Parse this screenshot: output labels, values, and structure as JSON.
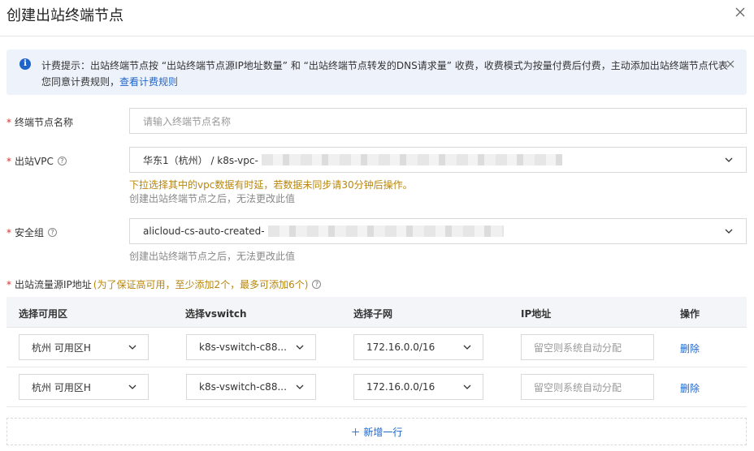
{
  "dialog": {
    "title": "创建出站终端节点"
  },
  "notice": {
    "text": "计费提示：出站终端节点按 “出站终端节点源IP地址数量” 和 “出站终端节点转发的DNS请求量” 收费，收费模式为按量付费后付费，主动添加出站终端节点代表您同意计费规则，",
    "link": "查看计费规则"
  },
  "form": {
    "name": {
      "label": "终端节点名称",
      "placeholder": "请输入终端节点名称"
    },
    "vpc": {
      "label": "出站VPC",
      "value": "华东1（杭州） / k8s-vpc-",
      "warning": "下拉选择其中的vpc数据有时延，若数据未同步请30分钟后操作。",
      "hint": "创建出站终端节点之后，无法更改此值"
    },
    "security_group": {
      "label": "安全组",
      "value": "alicloud-cs-auto-created-",
      "hint": "创建出站终端节点之后，无法更改此值"
    },
    "source_ip": {
      "label": "出站流量源IP地址",
      "note": "(为了保证高可用，至少添加2个，最多可添加6个)"
    }
  },
  "table": {
    "headers": [
      "选择可用区",
      "选择vswitch",
      "选择子网",
      "IP地址",
      "操作"
    ],
    "rows": [
      {
        "zone": "杭州 可用区H",
        "vswitch": "k8s-vswitch-c88...",
        "subnet": "172.16.0.0/16",
        "ip_placeholder": "留空则系统自动分配",
        "action": "删除"
      },
      {
        "zone": "杭州 可用区H",
        "vswitch": "k8s-vswitch-c88...",
        "subnet": "172.16.0.0/16",
        "ip_placeholder": "留空则系统自动分配",
        "action": "删除"
      }
    ],
    "add_row": "＋ 新增一行"
  },
  "colors": {
    "accent": "#1f64c8",
    "required": "#d93026",
    "warning": "#b8860b",
    "notice_bg": "#eef3fb"
  }
}
